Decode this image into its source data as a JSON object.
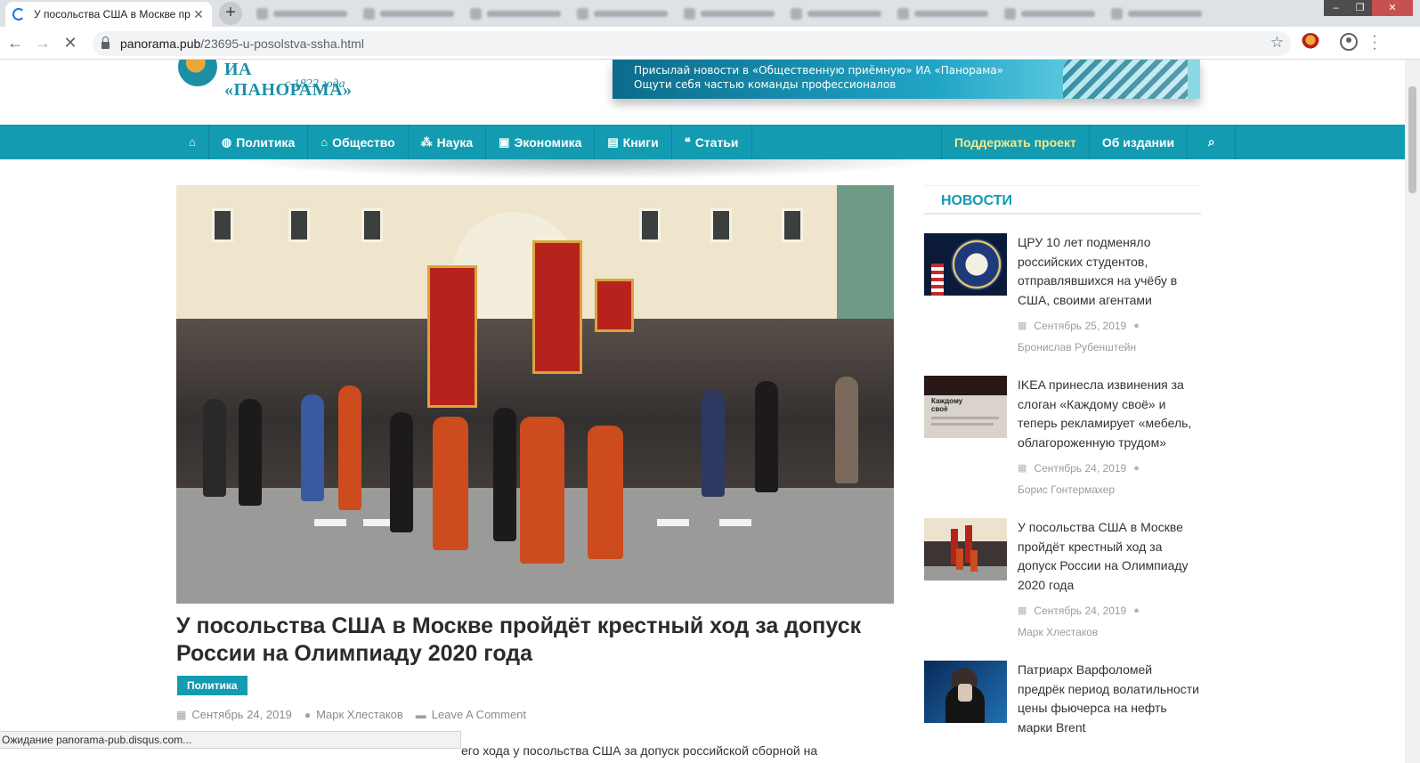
{
  "browser": {
    "active_tab_title": "У посольства США в Москве пр",
    "url_host": "panorama.pub",
    "url_path": "/23695-u-posolstva-ssha.html",
    "status_text": "Ожидание panorama-pub.disqus.com..."
  },
  "site": {
    "logo_name": "ИА «ПАНОРАМА»",
    "logo_since": "с 1822 года",
    "banner_line1": "Присылай новости в «Общественную приёмную» ИА «Панорама»",
    "banner_line2": "Ощути себя частью команды профессионалов"
  },
  "nav": {
    "items": [
      {
        "label": "",
        "icon": "home-icon"
      },
      {
        "label": "Политика",
        "icon": "globe-icon"
      },
      {
        "label": "Общество",
        "icon": "bank-icon"
      },
      {
        "label": "Наука",
        "icon": "cubes-icon"
      },
      {
        "label": "Экономика",
        "icon": "money-icon"
      },
      {
        "label": "Книги",
        "icon": "book-icon"
      },
      {
        "label": "Статьи",
        "icon": "quote-icon"
      }
    ],
    "support": "Поддержать проект",
    "about": "Об издании",
    "accent": "#139bb1"
  },
  "article": {
    "title": "У посольства США в Москве пройдёт крестный ход за допуск России на Олимпиаду 2020 года",
    "category": "Политика",
    "date": "Сентябрь 24, 2019",
    "author": "Марк Хлестаков",
    "comments": "Leave A Comment",
    "body_peek": "его хода у посольства США за допуск российской сборной на"
  },
  "sidebar": {
    "title": "НОВОСТИ",
    "items": [
      {
        "title": "ЦРУ 10 лет подменяло российских студентов, отправлявшихся на учёбу в США, своими агентами",
        "date": "Сентябрь 25, 2019",
        "author": "Бронислав Рубенштейн"
      },
      {
        "title": "IKEA принесла извинения за слоган «Каждому своё» и теперь рекламирует «мебель, облагороженную трудом»",
        "date": "Сентябрь 24, 2019",
        "author": "Борис Гонтермахер"
      },
      {
        "title": "У посольства США в Москве пройдёт крестный ход за допуск России на Олимпиаду 2020 года",
        "date": "Сентябрь 24, 2019",
        "author": "Марк Хлестаков"
      },
      {
        "title": "Патриарх Варфоломей предрёк период волатильности цены фьючерса на нефть марки Brent",
        "date": "",
        "author": ""
      }
    ],
    "thumb2_text": "Каждому своё"
  }
}
